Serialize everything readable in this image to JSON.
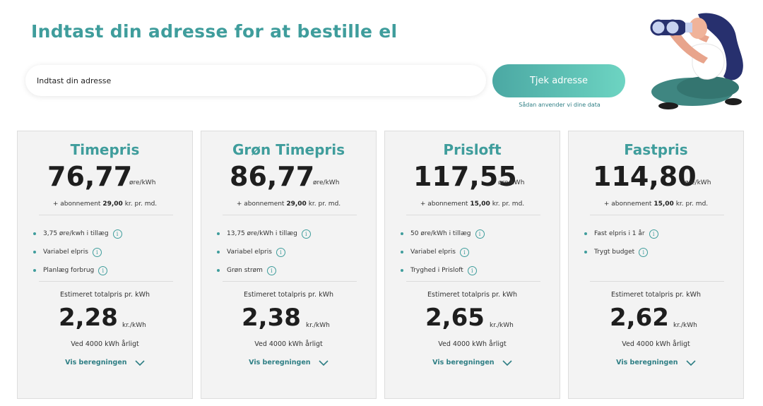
{
  "header": {
    "title": "Indtast din adresse for at bestille el",
    "address_placeholder": "Indtast din adresse",
    "check_button": "Tjek adresse",
    "data_link": "Sådan anvender vi dine data"
  },
  "illustration": {
    "icon": "woman-with-binoculars-illustration"
  },
  "colors": {
    "accent": "#3f9d9c",
    "button_start": "#4ba8a3",
    "button_end": "#6dd4c2",
    "card_bg": "#f3f3f3"
  },
  "cards": [
    {
      "name": "Timepris",
      "price": "76,77",
      "price_unit": "øre/kWh",
      "subscription_prefix": "+ abonnement",
      "subscription_amount": "29,00",
      "subscription_suffix": "kr. pr. md.",
      "features": [
        "3,75 øre/kwh i tillæg",
        "Variabel elpris",
        "Planlæg forbrug"
      ],
      "estimate_label": "Estimeret totalpris pr. kWh",
      "total": "2,28",
      "total_unit": "kr./kWh",
      "annual": "Ved 4000 kWh årligt",
      "calc_link": "Vis beregningen"
    },
    {
      "name": "Grøn Timepris",
      "price": "86,77",
      "price_unit": "øre/kWh",
      "subscription_prefix": "+ abonnement",
      "subscription_amount": "29,00",
      "subscription_suffix": "kr. pr. md.",
      "features": [
        "13,75 øre/kWh i tillæg",
        "Variabel elpris",
        "Grøn strøm"
      ],
      "estimate_label": "Estimeret totalpris pr. kWh",
      "total": "2,38",
      "total_unit": "kr./kWh",
      "annual": "Ved 4000 kWh årligt",
      "calc_link": "Vis beregningen"
    },
    {
      "name": "Prisloft",
      "price": "117,55",
      "price_unit": "øre/kWh",
      "subscription_prefix": "+ abonnement",
      "subscription_amount": "15,00",
      "subscription_suffix": "kr. pr. md.",
      "features": [
        "50 øre/kWh i tillæg",
        "Variabel elpris",
        "Tryghed i Prisloft"
      ],
      "estimate_label": "Estimeret totalpris pr. kWh",
      "total": "2,65",
      "total_unit": "kr./kWh",
      "annual": "Ved 4000 kWh årligt",
      "calc_link": "Vis beregningen"
    },
    {
      "name": "Fastpris",
      "price": "114,80",
      "price_unit": "øre/kWh",
      "subscription_prefix": "+ abonnement",
      "subscription_amount": "15,00",
      "subscription_suffix": "kr. pr. md.",
      "features": [
        "Fast elpris i 1 år",
        "Trygt budget"
      ],
      "estimate_label": "Estimeret totalpris pr. kWh",
      "total": "2,62",
      "total_unit": "kr./kWh",
      "annual": "Ved 4000 kWh årligt",
      "calc_link": "Vis beregningen"
    }
  ]
}
